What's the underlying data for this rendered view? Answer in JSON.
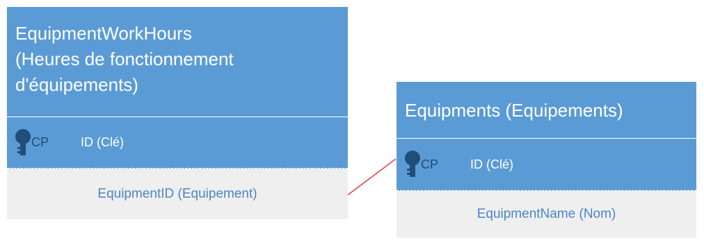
{
  "colors": {
    "header": "#5b9bd5",
    "key_icon": "#1f4e79",
    "attribute_bg": "#efefef",
    "attribute_text": "#4a86c5",
    "relationship_line": "#e02020"
  },
  "entities": {
    "work_hours": {
      "title_lines": [
        "EquipmentWorkHours",
        "(Heures de fonctionnement",
        "d'équipements)"
      ],
      "pk_label": "CP",
      "pk_field": "ID (Clé)",
      "key_icon": "key-icon",
      "attributes": [
        "EquipmentID (Equipement)"
      ]
    },
    "equipments": {
      "title": "Equipments (Equipements)",
      "pk_label": "CP",
      "pk_field": "ID (Clé)",
      "key_icon": "key-icon",
      "attributes": [
        "EquipmentName (Nom)"
      ]
    }
  }
}
